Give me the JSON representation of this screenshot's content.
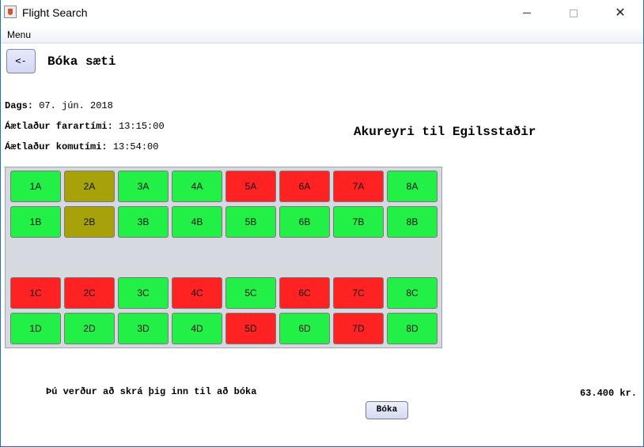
{
  "window": {
    "title": "Flight Search",
    "minimize": "",
    "maximize": "",
    "close": "✕"
  },
  "menubar": {
    "menu_label": "Menu"
  },
  "header": {
    "back_label": "<-",
    "title": "Bóka sæti"
  },
  "flight_info": {
    "date_label": "Dags:",
    "date_value": "07. jún. 2018",
    "departure_label": "Áætlaður farartími:",
    "departure_value": "13:15:00",
    "arrival_label": "Áætlaður komutími:",
    "arrival_value": "13:54:00",
    "route": "Akureyri til Egilsstaðir"
  },
  "colors": {
    "available": "#22f046",
    "taken": "#ff2222",
    "selected": "#a8a20a"
  },
  "seats": [
    {
      "label": "1A",
      "status": "available"
    },
    {
      "label": "2A",
      "status": "selected"
    },
    {
      "label": "3A",
      "status": "available"
    },
    {
      "label": "4A",
      "status": "available"
    },
    {
      "label": "5A",
      "status": "taken"
    },
    {
      "label": "6A",
      "status": "taken"
    },
    {
      "label": "7A",
      "status": "taken"
    },
    {
      "label": "8A",
      "status": "available"
    },
    {
      "label": "1B",
      "status": "available"
    },
    {
      "label": "2B",
      "status": "selected"
    },
    {
      "label": "3B",
      "status": "available"
    },
    {
      "label": "4B",
      "status": "available"
    },
    {
      "label": "5B",
      "status": "available"
    },
    {
      "label": "6B",
      "status": "available"
    },
    {
      "label": "7B",
      "status": "available"
    },
    {
      "label": "8B",
      "status": "available"
    },
    {
      "label": "1C",
      "status": "taken"
    },
    {
      "label": "2C",
      "status": "taken"
    },
    {
      "label": "3C",
      "status": "available"
    },
    {
      "label": "4C",
      "status": "taken"
    },
    {
      "label": "5C",
      "status": "available"
    },
    {
      "label": "6C",
      "status": "taken"
    },
    {
      "label": "7C",
      "status": "taken"
    },
    {
      "label": "8C",
      "status": "available"
    },
    {
      "label": "1D",
      "status": "available"
    },
    {
      "label": "2D",
      "status": "available"
    },
    {
      "label": "3D",
      "status": "available"
    },
    {
      "label": "4D",
      "status": "available"
    },
    {
      "label": "5D",
      "status": "taken"
    },
    {
      "label": "6D",
      "status": "available"
    },
    {
      "label": "7D",
      "status": "taken"
    },
    {
      "label": "8D",
      "status": "available"
    }
  ],
  "footer": {
    "login_note": "Þú verður að skrá þig inn til að bóka",
    "book_label": "Bóka",
    "price": "63.400 kr."
  }
}
